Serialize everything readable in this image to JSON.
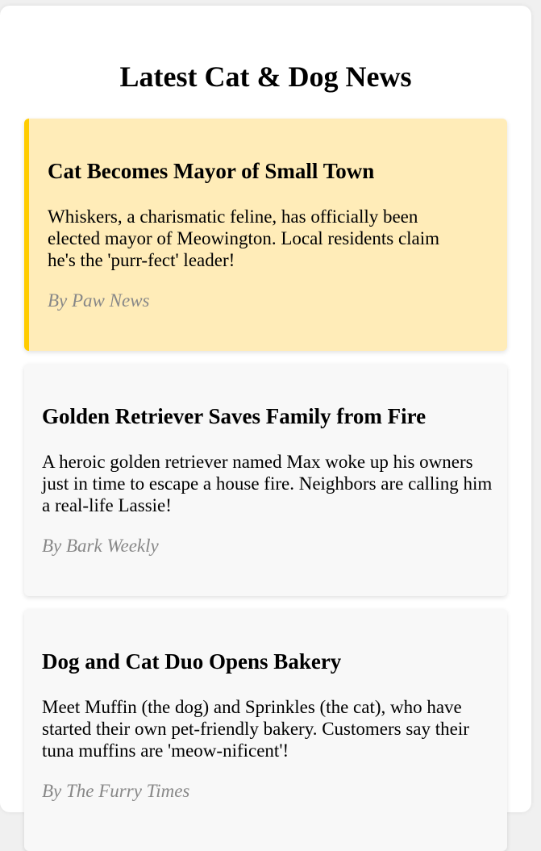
{
  "page": {
    "title": "Latest Cat & Dog News"
  },
  "articles": [
    {
      "title": "Cat Becomes Mayor of Small Town",
      "body": "Whiskers, a charismatic feline, has officially been elected mayor of Meowington. Local residents claim he's the 'purr-fect' leader!",
      "byline": "By Paw News",
      "featured": true
    },
    {
      "title": "Golden Retriever Saves Family from Fire",
      "body": "A heroic golden retriever named Max woke up his owners just in time to escape a house fire. Neighbors are calling him a real-life Lassie!",
      "byline": "By Bark Weekly",
      "featured": false
    },
    {
      "title": "Dog and Cat Duo Opens Bakery",
      "body": "Meet Muffin (the dog) and Sprinkles (the cat), who have started their own pet-friendly bakery. Customers say their tuna muffins are 'meow-nificent'!",
      "byline": "By The Furry Times",
      "featured": false
    }
  ],
  "colors": {
    "featured_background": "#ffecb8",
    "featured_accent": "#ffcc00",
    "card_background": "#f8f8f8",
    "byline_text": "#888888"
  }
}
